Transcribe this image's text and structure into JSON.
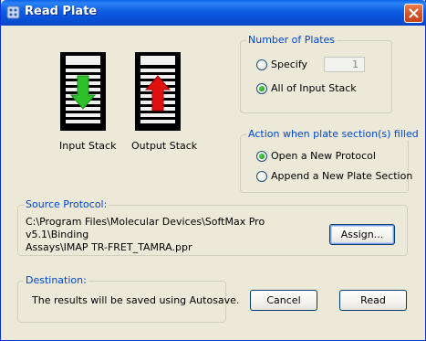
{
  "window": {
    "title": "Read Plate",
    "title_icon": "app-icon",
    "close_icon": "close-icon"
  },
  "stacks": {
    "input_label": "Input Stack",
    "output_label": "Output Stack",
    "input_arrow_color": "#2fc12b",
    "output_arrow_color": "#e01010"
  },
  "number_of_plates": {
    "label": "Number of Plates",
    "options": [
      {
        "label": "Specify",
        "checked": false
      },
      {
        "label": "All of Input Stack",
        "checked": true
      }
    ],
    "specify_value": "1"
  },
  "action": {
    "label": "Action when plate section(s) filled",
    "options": [
      {
        "label": "Open a New Protocol",
        "checked": true
      },
      {
        "label": "Append a New Plate Section",
        "checked": false
      }
    ]
  },
  "source_protocol": {
    "label": "Source Protocol:",
    "path_line1": "C:\\Program Files\\Molecular Devices\\SoftMax Pro v5.1\\Binding",
    "path_line2": "Assays\\IMAP TR-FRET_TAMRA.ppr",
    "assign_label": "Assign..."
  },
  "destination": {
    "label": "Destination:",
    "text": "The results will be saved using Autosave."
  },
  "buttons": {
    "cancel": "Cancel",
    "read": "Read"
  },
  "colors": {
    "titlebar": "#0a50d6",
    "group_label": "#0046d5",
    "dialog_bg": "#ece9d8"
  }
}
